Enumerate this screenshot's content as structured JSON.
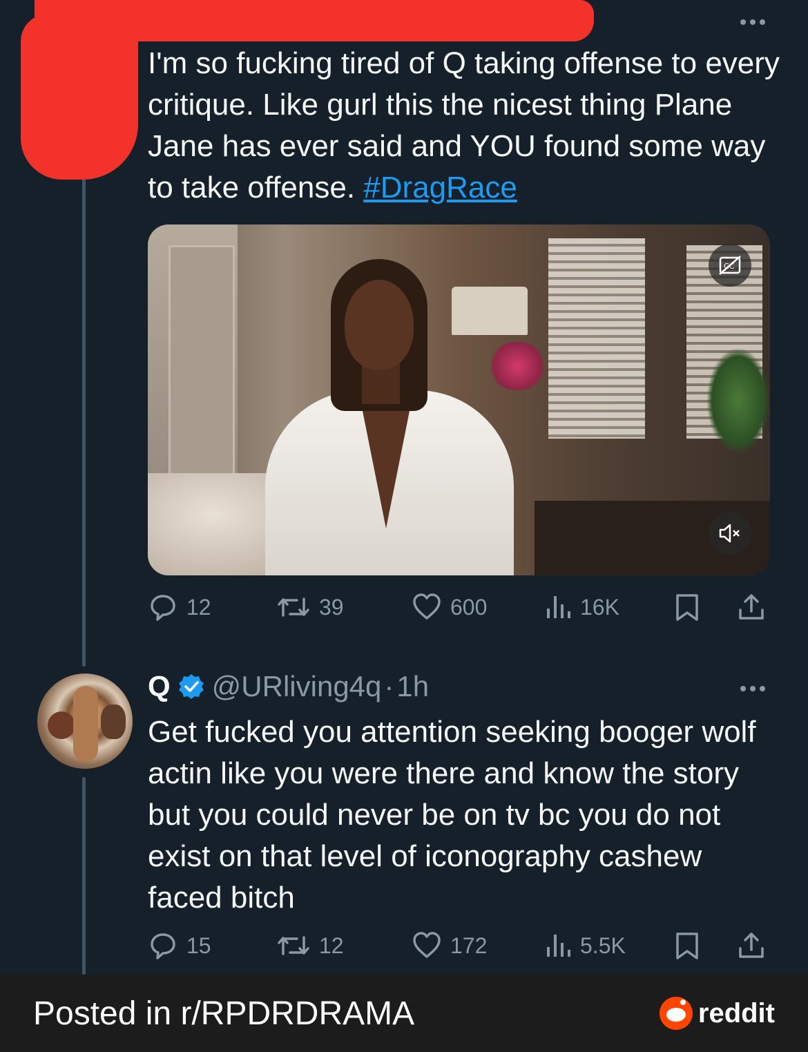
{
  "first_tweet": {
    "text": "I'm  so fucking tired of Q taking offense to every critique. Like gurl this the nicest thing Plane Jane has ever said and YOU found some way to take offense. ",
    "hashtag": "#DragRace",
    "media": {
      "captions_icon": "captions-off-icon",
      "mute_icon": "mute-icon"
    },
    "metrics": {
      "replies": "12",
      "retweets": "39",
      "likes": "600",
      "views": "16K"
    }
  },
  "reply_tweet": {
    "display_name": "Q",
    "verified_icon": "verified-badge-icon",
    "handle": "@URliving4q",
    "separator": "·",
    "time": "1h",
    "text": "Get fucked you attention seeking booger wolf actin like you were there and know the story but you could never be on tv bc you do not exist on that level of iconography cashew faced bitch",
    "metrics": {
      "replies": "15",
      "retweets": "12",
      "likes": "172",
      "views": "5.5K"
    }
  },
  "footer": {
    "posted_in": "Posted in r/RPDRDRAMA",
    "brand": "reddit"
  },
  "colors": {
    "background": "#15202b",
    "text": "#f7f9f9",
    "muted": "#8b98a5",
    "link": "#1d9bf0",
    "verified": "#1d9bf0",
    "redaction": "#f2322b",
    "reddit_orange": "#ff4500"
  }
}
